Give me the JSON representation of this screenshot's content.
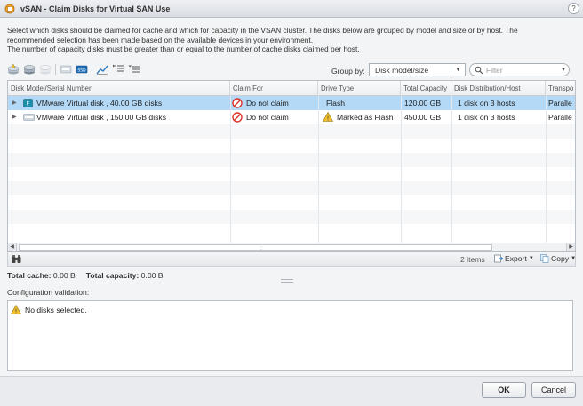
{
  "window": {
    "title": "vSAN - Claim Disks for Virtual SAN Use",
    "help": "?"
  },
  "description": [
    "Select which disks should be claimed for cache and which for capacity in the VSAN cluster. The disks below are grouped by model and size or by host. The",
    "recommended selection has been made based on the available devices in your environment.",
    "The number of capacity disks must be greater than or equal to the number of cache disks claimed per host."
  ],
  "toolbar": {
    "icons": [
      "claim-cache-icon",
      "claim-capacity-icon",
      "do-not-claim-icon",
      "mark-hdd-icon",
      "mark-ssd-icon",
      "chart-icon",
      "expand-all-icon",
      "collapse-all-icon"
    ],
    "group_by_label": "Group by:",
    "group_by_value": "Disk model/size",
    "filter_placeholder": "Filter"
  },
  "grid": {
    "columns": [
      "Disk Model/Serial Number",
      "Claim For",
      "Drive Type",
      "Total Capacity",
      "Disk Distribution/Host",
      "Transpo"
    ],
    "rows": [
      {
        "model": "VMware  Virtual disk   , 40.00 GB disks",
        "claim": "Do not claim",
        "drive_type": "Flash",
        "capacity": "120.00 GB",
        "distribution": "1 disk on 3 hosts",
        "transport": "Paralle",
        "selected": true,
        "badge": "F"
      },
      {
        "model": "VMware  Virtual disk   , 150.00 GB disks",
        "claim": "Do not claim",
        "drive_type": "Marked as Flash",
        "capacity": "450.00 GB",
        "distribution": "1 disk on 3 hosts",
        "transport": "Paralle",
        "selected": false,
        "badge": ""
      }
    ],
    "footer": {
      "items": "2 items",
      "export": "Export",
      "copy": "Copy"
    }
  },
  "totals": {
    "cache_label": "Total cache:",
    "cache_value": "0.00 B",
    "capacity_label": "Total capacity:",
    "capacity_value": "0.00 B"
  },
  "validation": {
    "label": "Configuration validation:",
    "message": "No disks selected."
  },
  "buttons": {
    "ok": "OK",
    "cancel": "Cancel"
  },
  "colors": {
    "selected_row": "#b3d9f7",
    "accent": "#1d6fb8",
    "warning": "#f2c12e",
    "error": "#d9362b"
  }
}
